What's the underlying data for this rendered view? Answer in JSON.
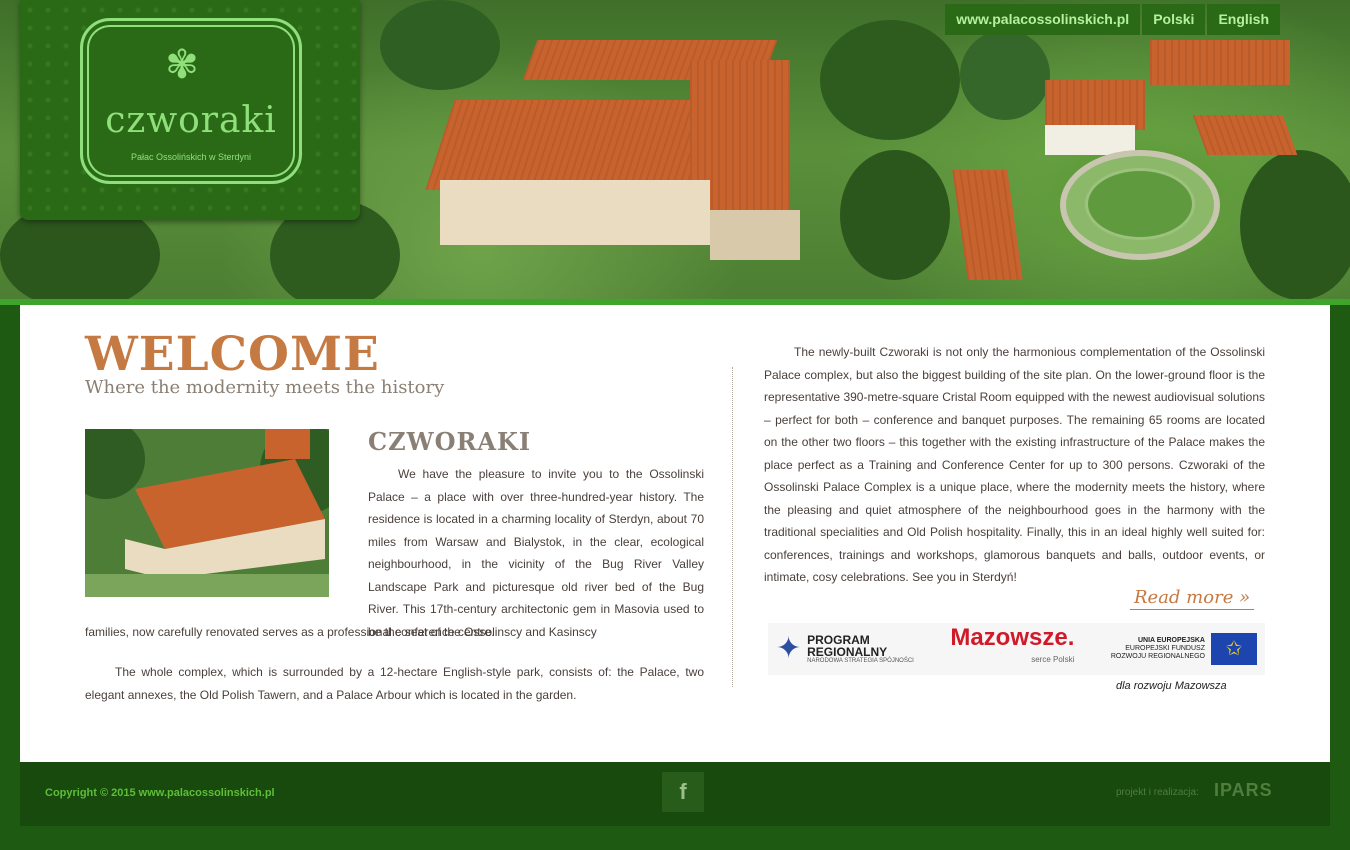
{
  "header": {
    "logo": {
      "name": "czworaki",
      "subtitle": "Pałac Ossolińskich w Sterdyni"
    },
    "nav": [
      {
        "label": "www.palacossolinskich.pl"
      },
      {
        "label": "Polski"
      },
      {
        "label": "English"
      }
    ]
  },
  "main": {
    "welcome_title": "WELCOME",
    "tagline": "Where the modernity meets the history",
    "section_title": "CZWORAKI",
    "paragraph1_a": "We have the pleasure to invite you to the Ossolinski Palace – a place with over three-hundred-year history. The residence is located in a charming locality of Sterdyn, about 70 miles from Warsaw and Bialystok, in the clear, ecological neighbourhood, in the vicinity of the Bug River Valley Landscape Park and picturesque old river bed of the Bug River. This 17th-century architectonic gem in Masovia used to be the seat of the Ossolinscy and Kasinscy",
    "paragraph1_b": "families, now carefully renovated serves as a professional conference centre.",
    "paragraph2": "The whole complex, which is surrounded by a 12-hectare English-style park, consists of: the Palace, two elegant annexes, the Old Polish Tawern, and a Palace Arbour which is located in the garden.",
    "paragraph3": "The newly-built Czworaki is not only the harmonious complementation of the Ossolinski Palace complex, but also the biggest building of the site plan. On the lower-ground floor is the representative 390-metre-square Cristal Room equipped with the newest audiovisual solutions – perfect for both – conference and banquet purposes. The remaining 65 rooms are located on the other two floors – this together with the existing infrastructure of the Palace makes the place perfect as a Training and Conference Center for up to 300 persons. Czworaki of the Ossolinski Palace Complex is a unique place, where the modernity meets the history, where the pleasing and quiet atmosphere of the neighbourhood goes in the harmony with the traditional specialities and Old Polish hospitality. Finally, this in an ideal highly well suited for: conferences, trainings and workshops, glamorous banquets and balls, outdoor events, or intimate, cosy celebrations. See you in Sterdyń!",
    "read_more": "Read more »"
  },
  "sponsors": {
    "program_line1": "PROGRAM",
    "program_line2": "REGIONALNY",
    "program_sub": "NARODOWA STRATEGIA SPÓJNOŚCI",
    "mazowsze": "Mazowsze.",
    "mazowsze_sub": "serce Polski",
    "eu_title": "UNIA EUROPEJSKA",
    "eu_line2": "EUROPEJSKI FUNDUSZ",
    "eu_line3": "ROZWOJU REGIONALNEGO",
    "caption": "dla rozwoju Mazowsza"
  },
  "footer": {
    "copyright": "Copyright © 2015 www.palacossolinskich.pl",
    "facebook": "f",
    "realizacja": "projekt i realizacja:",
    "agency": "IPARS"
  },
  "colors": {
    "brand_green": "#2a6a17",
    "accent_green": "#8fe07a",
    "accent_copper": "#c67a43"
  }
}
